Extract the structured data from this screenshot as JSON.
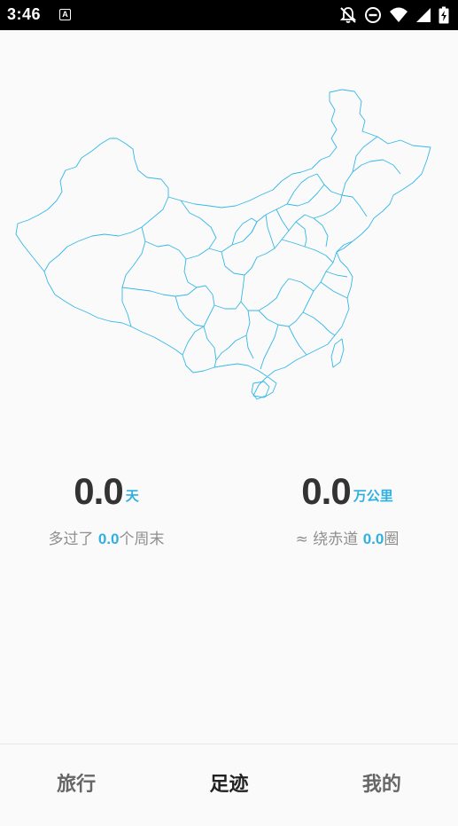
{
  "status_bar": {
    "time": "3:46",
    "app_icon_letter": "A",
    "icons": [
      "bell-off-icon",
      "do-not-disturb-icon",
      "wifi-icon",
      "signal-icon",
      "battery-charging-icon"
    ]
  },
  "map": {
    "stroke_color": "#36b8e6",
    "icon": "china-map"
  },
  "stats": {
    "days": {
      "value": "0.0",
      "unit": "天",
      "sub_prefix": "多过了",
      "sub_value": "0.0",
      "sub_suffix": "个周末"
    },
    "distance": {
      "value": "0.0",
      "unit": "万公里",
      "sub_prefix": "≈ 绕赤道",
      "sub_value": "0.0",
      "sub_suffix": "圈"
    }
  },
  "nav": {
    "items": [
      {
        "label": "旅行",
        "active": false
      },
      {
        "label": "足迹",
        "active": true
      },
      {
        "label": "我的",
        "active": false
      }
    ]
  },
  "colors": {
    "accent": "#2fb0e0",
    "text_dark": "#333333",
    "text_gray": "#8f8f8f",
    "background": "#fafafa"
  }
}
